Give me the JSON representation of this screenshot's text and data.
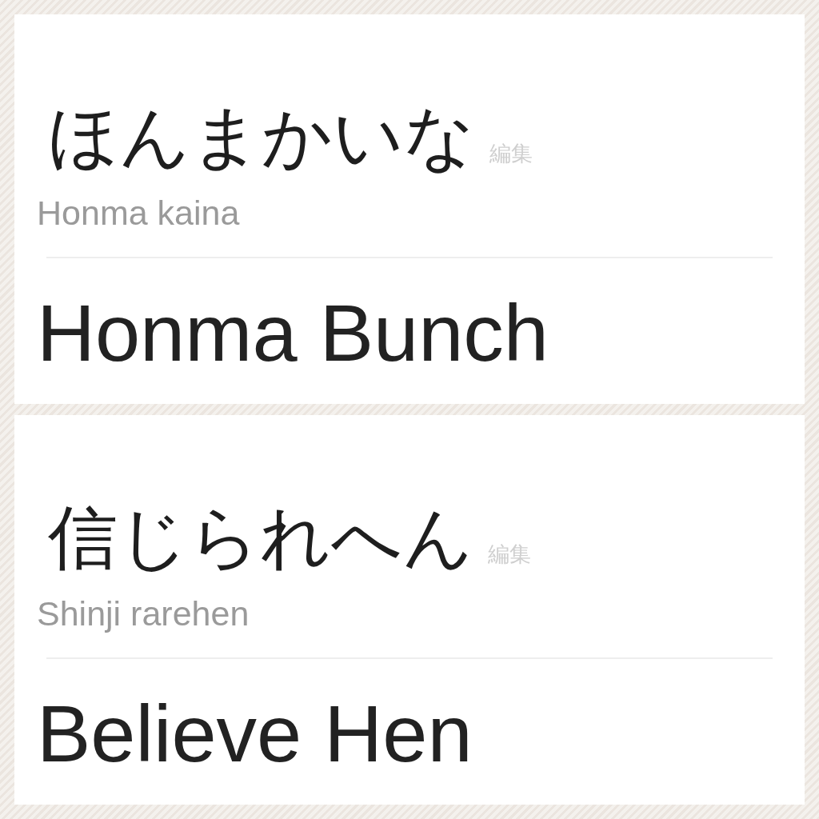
{
  "panels": [
    {
      "phrase": "ほんまかいな",
      "edit_link": "編集",
      "romanization": "Honma kaina",
      "translation": "Honma Bunch"
    },
    {
      "phrase": "信じられへん",
      "edit_link": "編集",
      "romanization": "Shinji rarehen",
      "translation": "Believe Hen"
    }
  ]
}
